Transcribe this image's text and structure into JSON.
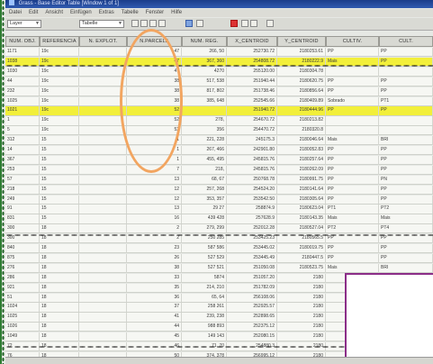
{
  "window": {
    "title": "Grass - Base Editor Table [Window 1 of 1]"
  },
  "menu": [
    "Datei",
    "Edit",
    "Ansicht",
    "Einfügen",
    "Extras",
    "Tabelle",
    "Fenster",
    "Hilfe"
  ],
  "toolbar": {
    "layer_combo": "Layer",
    "sort_combo": "Tabelle"
  },
  "columns": [
    "NUM. OBJ.",
    "REFERENCIA",
    "N. EXPLOT.",
    "N.PARCELA",
    "NUM. REG.",
    "X_CENTROID",
    "Y_CENTROID",
    "CULTIV.",
    "CULT."
  ],
  "rows": [
    {
      "c": [
        "1171",
        "19c",
        "",
        "47",
        "266, 50",
        "252730.72",
        "2180253.61",
        "PP",
        "PP"
      ],
      "hl": false
    },
    {
      "c": [
        "1038",
        "19c",
        "",
        "47",
        "367, 360",
        "254808.72",
        "2180222.9",
        "Mais",
        "PP"
      ],
      "hl": true
    },
    {
      "c": [
        "1030",
        "19c",
        "",
        "47",
        "4270",
        "255120.00",
        "2180304.78",
        "",
        ""
      ],
      "hl": false
    },
    {
      "c": [
        "44",
        "19c",
        "",
        "38",
        "517, 538",
        "251940.44",
        "2180620.75",
        "PP",
        "PP"
      ],
      "hl": false
    },
    {
      "c": [
        "232",
        "19c",
        "",
        "38",
        "817, 802",
        "251738.46",
        "2180856.64",
        "PP",
        "PP"
      ],
      "hl": false
    },
    {
      "c": [
        "1025",
        "19c",
        "",
        "38",
        "385, 648",
        "252545.66",
        "2180409.89",
        "Sobrado",
        "PT1"
      ],
      "hl": false
    },
    {
      "c": [
        "1021",
        "19c",
        "",
        "52",
        "",
        "251940.72",
        "2180444.96",
        "PP",
        "PP"
      ],
      "hl": true
    },
    {
      "c": [
        "1",
        "19c",
        "",
        "52",
        "278,",
        "254670.72",
        "2180213.82",
        "",
        ""
      ],
      "hl": false
    },
    {
      "c": [
        "5",
        "19c",
        "",
        "52",
        "356",
        "254470.72",
        "2180320.8",
        "",
        ""
      ],
      "hl": false
    },
    {
      "c": [
        "312",
        "15",
        "",
        "1",
        "221, 228",
        "245175.3",
        "2180046.64",
        "Mais",
        "BRI"
      ],
      "hl": false
    },
    {
      "c": [
        "14",
        "15",
        "",
        "1",
        "267, 466",
        "242901.80",
        "2180052.83",
        "PP",
        "PP"
      ],
      "hl": false
    },
    {
      "c": [
        "367",
        "15",
        "",
        "1",
        "455, 495",
        "245815.76",
        "2180257.64",
        "PP",
        "PP"
      ],
      "hl": false
    },
    {
      "c": [
        "253",
        "15",
        "",
        "7",
        "218,",
        "245815.76",
        "2180262.09",
        "PP",
        "PP"
      ],
      "hl": false
    },
    {
      "c": [
        "57",
        "15",
        "",
        "13",
        "68, 67",
        "250768.78",
        "2180991.75",
        "PP",
        "PN"
      ],
      "hl": false
    },
    {
      "c": [
        "218",
        "15",
        "",
        "12",
        "257, 268",
        "254524.20",
        "2180141.64",
        "PP",
        "PP"
      ],
      "hl": false
    },
    {
      "c": [
        "249",
        "15",
        "",
        "12",
        "353, 357",
        "253542.50",
        "2180305.64",
        "PP",
        "PP"
      ],
      "hl": false
    },
    {
      "c": [
        "91",
        "15",
        "",
        "13",
        "29 27",
        "258874.9",
        "2180623.04",
        "PT1",
        "PT2"
      ],
      "hl": false
    },
    {
      "c": [
        "831",
        "15",
        "",
        "16",
        "439 428",
        "257628.9",
        "2180143.35",
        "Mais",
        "Mais"
      ],
      "hl": false
    },
    {
      "c": [
        "300",
        "18",
        "",
        "2",
        "279, 299",
        "252012.28",
        "2180527.04",
        "PT2",
        "PT4"
      ],
      "hl": false
    },
    {
      "c": [
        "300",
        "18",
        "",
        "2",
        "250 285",
        "253425.23",
        "2180565.5",
        "PP",
        "PP"
      ],
      "hl": false
    },
    {
      "c": [
        "840",
        "18",
        "",
        "23",
        "587 586",
        "253445.02",
        "2180019.75",
        "PP",
        "PP"
      ],
      "hl": false
    },
    {
      "c": [
        "875",
        "18",
        "",
        "26",
        "527 529",
        "253445.49",
        "2180447.5",
        "PP",
        "PP"
      ],
      "hl": false
    },
    {
      "c": [
        "276",
        "18",
        "",
        "38",
        "527 521",
        "251050.08",
        "2180523.75",
        "Mais",
        "BRI"
      ],
      "hl": false
    },
    {
      "c": [
        "286",
        "18",
        "",
        "33",
        "5874",
        "251057.20",
        "2180",
        "",
        ""
      ],
      "hl": false
    },
    {
      "c": [
        "921",
        "18",
        "",
        "35",
        "214, 210",
        "251782.09",
        "2180",
        "",
        ""
      ],
      "hl": false
    },
    {
      "c": [
        "51",
        "18",
        "",
        "36",
        "65, 64",
        "256108.06",
        "2180",
        "",
        ""
      ],
      "hl": false
    },
    {
      "c": [
        "1024",
        "18",
        "",
        "37",
        "258 261",
        "252925.57",
        "2180",
        "",
        ""
      ],
      "hl": false
    },
    {
      "c": [
        "1025",
        "18",
        "",
        "41",
        "239, 238",
        "252898.65",
        "2180",
        "",
        ""
      ],
      "hl": false
    },
    {
      "c": [
        "1026",
        "18",
        "",
        "44",
        "988 893",
        "252375.12",
        "2180",
        "",
        ""
      ],
      "hl": false
    },
    {
      "c": [
        "1049",
        "18",
        "",
        "45",
        "149 143",
        "252080.15",
        "2180",
        "",
        ""
      ],
      "hl": false
    },
    {
      "c": [
        "72",
        "18",
        "",
        "46",
        "71, 70",
        "254880.3",
        "2180",
        "",
        ""
      ],
      "hl": false
    },
    {
      "c": [
        "76",
        "18",
        "",
        "50",
        "374, 378",
        "256995.12",
        "2180",
        "",
        ""
      ],
      "hl": false
    }
  ],
  "colors": {
    "highlight": "#f2ef3a",
    "annotation_oval": "#f2a560",
    "green_margin": "#2e7d32",
    "purple_box": "#8b2d88"
  },
  "icons": [
    "app-icon",
    "save-icon",
    "cut-icon",
    "copy-icon",
    "paste-icon",
    "delete-icon",
    "find-icon"
  ]
}
